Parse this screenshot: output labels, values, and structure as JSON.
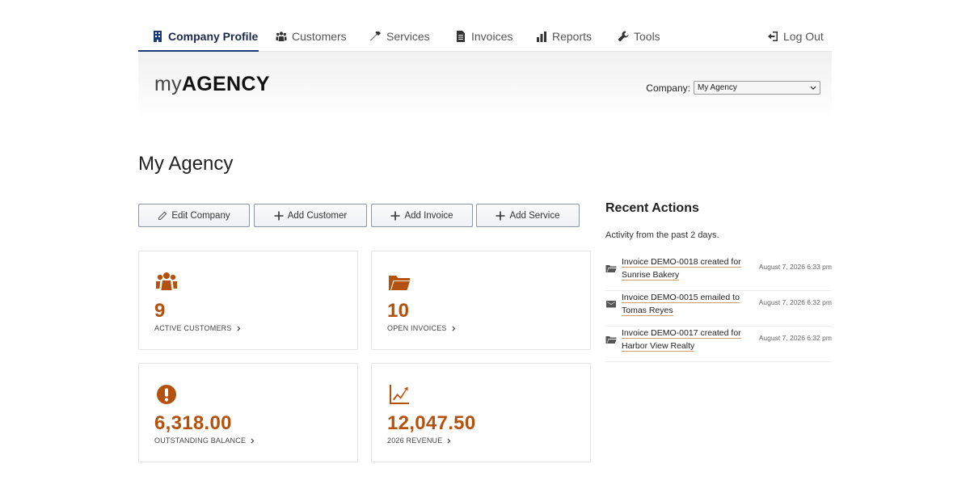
{
  "nav": {
    "items": [
      {
        "label": "Company Profile",
        "icon": "building-icon"
      },
      {
        "label": "Customers",
        "icon": "users-icon"
      },
      {
        "label": "Services",
        "icon": "hammer-icon"
      },
      {
        "label": "Invoices",
        "icon": "document-icon"
      },
      {
        "label": "Reports",
        "icon": "bar-chart-icon"
      },
      {
        "label": "Tools",
        "icon": "wrench-icon"
      }
    ],
    "logout": "Log Out"
  },
  "header": {
    "logo_my": "my",
    "logo_agency": "AGENCY",
    "company_label": "Company:",
    "company_selected": "My Agency"
  },
  "page": {
    "title": "My Agency"
  },
  "actions": {
    "edit": "Edit Company",
    "add_customer": "Add Customer",
    "add_invoice": "Add Invoice",
    "add_service": "Add Service"
  },
  "stats": [
    {
      "value": "9",
      "label": "ACTIVE CUSTOMERS",
      "icon": "users-icon"
    },
    {
      "value": "10",
      "label": "OPEN INVOICES",
      "icon": "folder-icon"
    },
    {
      "value": "6,318.00",
      "label": "OUTSTANDING BALANCE",
      "icon": "alert-icon"
    },
    {
      "value": "12,047.50",
      "label": "2026 REVENUE",
      "icon": "trend-icon"
    }
  ],
  "recent": {
    "title": "Recent Actions",
    "subtitle": "Activity from the past 2 days.",
    "items": [
      {
        "text": "Invoice DEMO-0018 created for Sunrise Bakery",
        "time": "August 7, 2026 6:33 pm",
        "icon": "folder-icon"
      },
      {
        "text": "Invoice DEMO-0015 emailed to Tomas Reyes",
        "time": "August 7, 2026 6:32 pm",
        "icon": "envelope-icon"
      },
      {
        "text": "Invoice DEMO-0017 created for Harbor View Realty",
        "time": "August 7, 2026 6:32 pm",
        "icon": "folder-icon"
      }
    ]
  },
  "colors": {
    "accent": "#b4520d",
    "nav_active": "#1b3a7a"
  }
}
